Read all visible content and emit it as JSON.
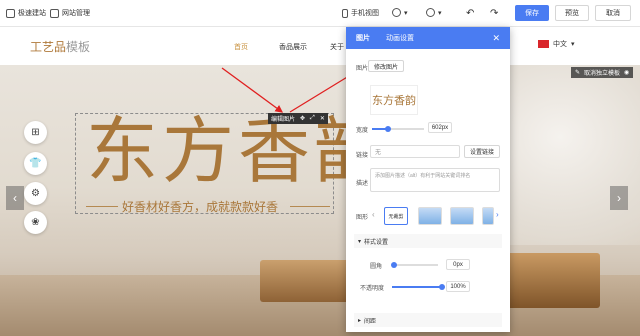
{
  "toolbar": {
    "quick_build": "极速建站",
    "site_manage": "网站管理",
    "mobile_view": "手机视图",
    "save": "保存",
    "preview": "预览",
    "cancel": "取消"
  },
  "site": {
    "logo_main": "工艺品",
    "logo_sub": "模板",
    "nav": [
      "首页",
      "香品展示",
      "关于"
    ],
    "lang": "中文"
  },
  "hero": {
    "title": "东方香韵",
    "subtitle": "好香材好香方，成就款款好香",
    "edit_tag": "编辑图片",
    "widget_tag": "取消独立模板"
  },
  "panel": {
    "tabs": [
      "图片",
      "动画设置"
    ],
    "image_label": "图片",
    "change_image": "修改图片",
    "preview_text": "东方香韵",
    "width_label": "宽度",
    "width_value": "602px",
    "width_fraction": 0.3,
    "link_label": "链接",
    "link_placeholder": "无",
    "link_button": "设置链接",
    "desc_label": "描述",
    "desc_placeholder": "添加图片描述（alt）有利于网站关键词排名",
    "shape_label": "图形",
    "shape_none": "无裁剪",
    "style_section": "样式设置",
    "radius_label": "圆角",
    "radius_value": "0px",
    "opacity_label": "不透明度",
    "opacity_value": "100%",
    "spacing_section": "间距"
  },
  "colors": {
    "accent": "#4a7cf2",
    "brand": "#a9773a"
  }
}
